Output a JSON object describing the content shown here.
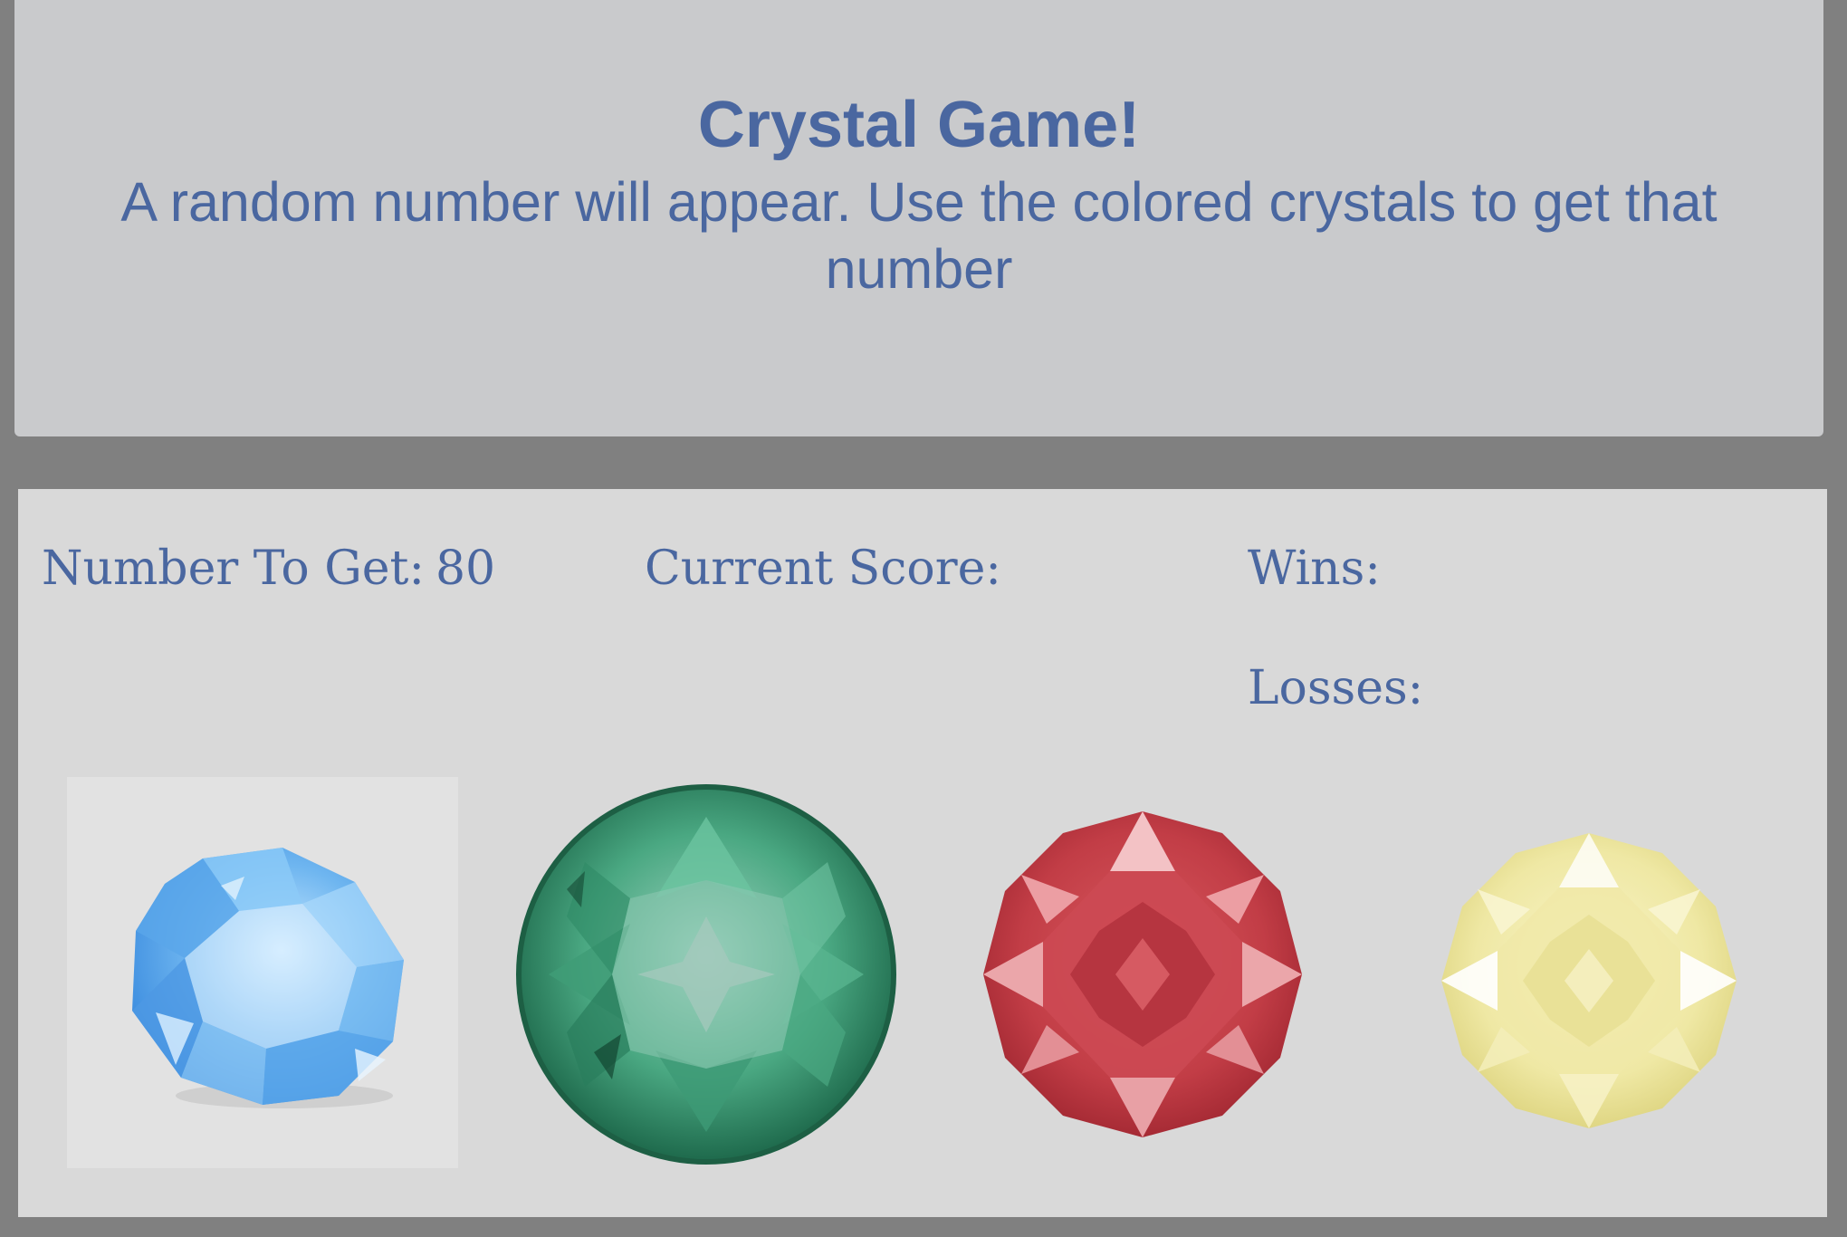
{
  "header": {
    "title": "Crystal Game!",
    "subtitle": "A random number will appear. Use the colored crystals to get that number"
  },
  "stats": {
    "target_label": "Number To Get:",
    "target_value": "80",
    "score_label": "Current Score:",
    "score_value": "",
    "wins_label": "Wins:",
    "wins_value": "",
    "losses_label": "Losses:",
    "losses_value": ""
  },
  "crystals": [
    {
      "name": "blue",
      "icon": "blue-crystal-icon",
      "color": "#5fa8ec"
    },
    {
      "name": "green",
      "icon": "green-crystal-icon",
      "color": "#3f9e78"
    },
    {
      "name": "red",
      "icon": "red-crystal-icon",
      "color": "#c9424c"
    },
    {
      "name": "yellow",
      "icon": "yellow-crystal-icon",
      "color": "#f1ecb0"
    }
  ],
  "colors": {
    "page_background": "#808080",
    "header_background": "#c9cacc",
    "panel_background": "#d9d9d9",
    "text": "#4a67a0"
  }
}
